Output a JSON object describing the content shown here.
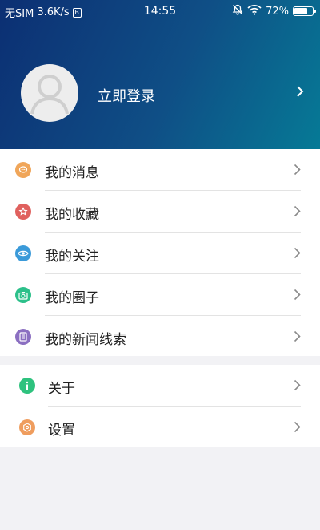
{
  "status_bar": {
    "carrier": "无SIM",
    "speed": "3.6K/s",
    "sim_badge": "B",
    "time": "14:55",
    "battery_percent": "72%",
    "battery_level": 0.72
  },
  "profile": {
    "login_label": "立即登录"
  },
  "menu": {
    "items": [
      {
        "label": "我的消息",
        "icon": "message-icon",
        "color": "#f0a65a"
      },
      {
        "label": "我的收藏",
        "icon": "star-icon",
        "color": "#e0615e"
      },
      {
        "label": "我的关注",
        "icon": "eye-icon",
        "color": "#3a9ad9"
      },
      {
        "label": "我的圈子",
        "icon": "camera-icon",
        "color": "#2cc08a"
      },
      {
        "label": "我的新闻线索",
        "icon": "document-icon",
        "color": "#8b6fc1"
      }
    ],
    "bottom_items": [
      {
        "label": "关于",
        "icon": "info-icon",
        "color": "#2ec27e"
      },
      {
        "label": "设置",
        "icon": "gear-icon",
        "color": "#ef9d5e"
      }
    ]
  },
  "colors": {
    "header_start": "#0c2f73",
    "header_end": "#067a96",
    "chevron": "#8a8a8a"
  }
}
